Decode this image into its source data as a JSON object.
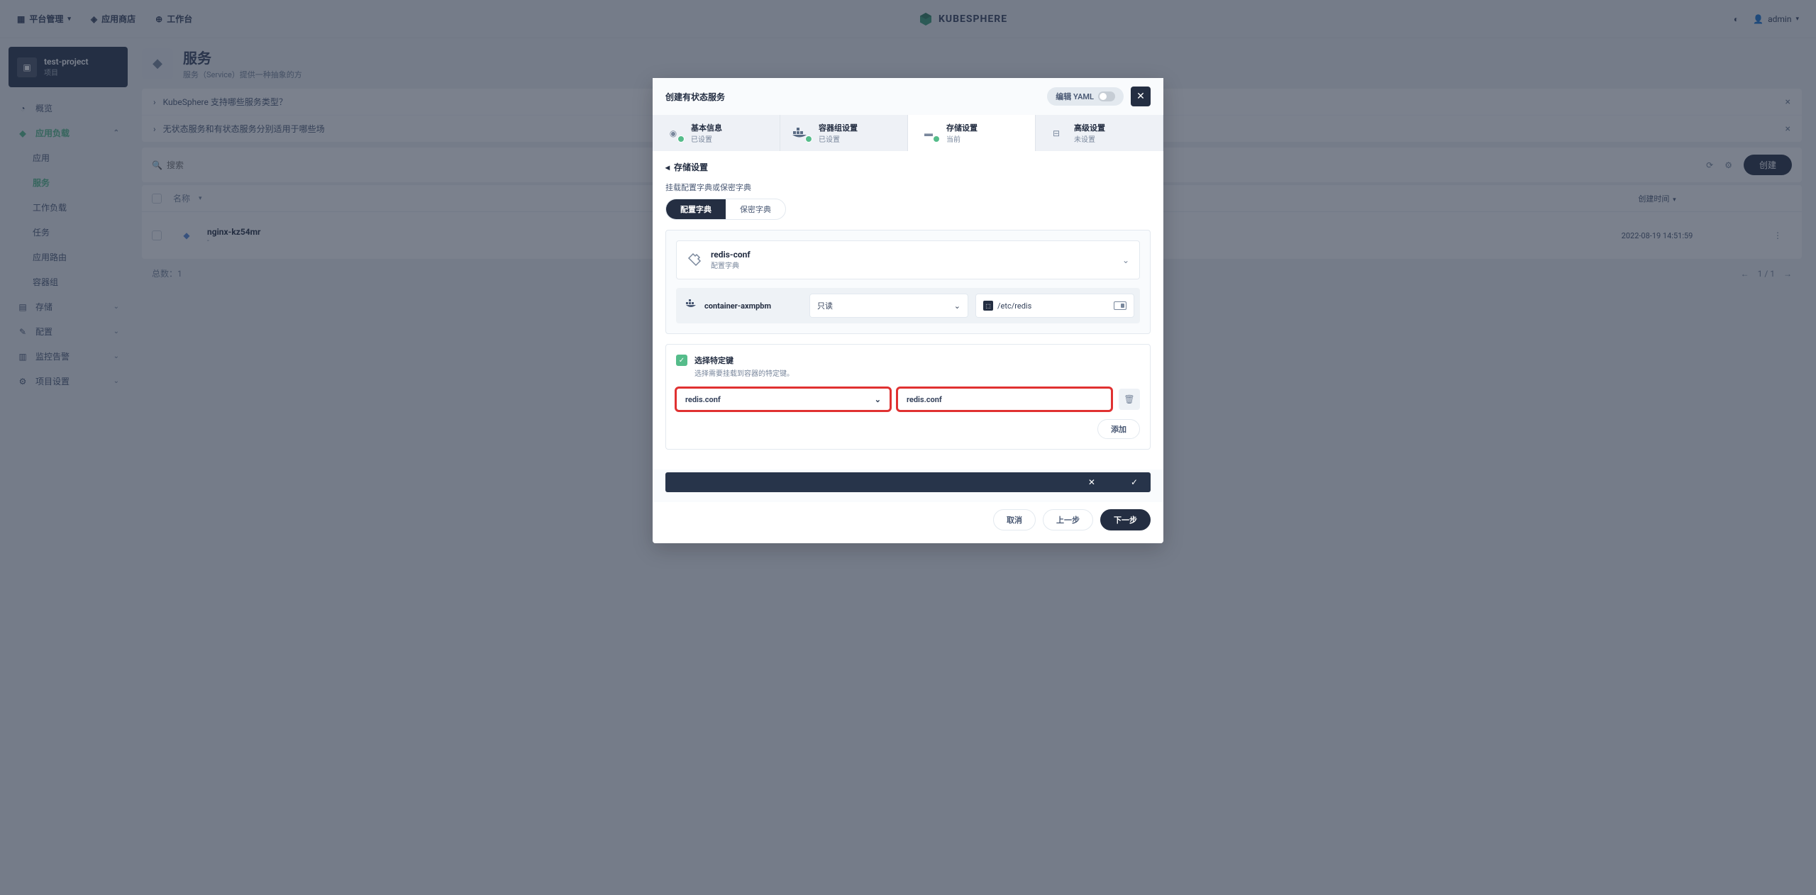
{
  "header": {
    "platform": "平台管理",
    "appstore": "应用商店",
    "workbench": "工作台",
    "brand": "KUBESPHERE",
    "user": "admin"
  },
  "sidebar": {
    "project_name": "test-project",
    "project_label": "项目",
    "items": [
      {
        "label": "概览"
      },
      {
        "label": "应用负载",
        "expanded": true
      },
      {
        "label": "应用",
        "sub": true
      },
      {
        "label": "服务",
        "sub": true,
        "active": true
      },
      {
        "label": "工作负载",
        "sub": true
      },
      {
        "label": "任务",
        "sub": true
      },
      {
        "label": "应用路由",
        "sub": true
      },
      {
        "label": "容器组",
        "sub": true
      },
      {
        "label": "存储",
        "chev": true
      },
      {
        "label": "配置",
        "chev": true
      },
      {
        "label": "监控告警",
        "chev": true
      },
      {
        "label": "项目设置",
        "chev": true
      }
    ]
  },
  "page": {
    "title": "服务",
    "desc": "服务（Service）提供一种抽象的方",
    "faq1": "KubeSphere 支持哪些服务类型？",
    "faq2": "无状态服务和有状态服务分别适用于哪些场"
  },
  "toolbar": {
    "search_ph": "搜索",
    "create": "创建"
  },
  "table": {
    "col_name": "名称",
    "col_time": "创建时间",
    "row_name": "nginx-kz54mr",
    "row_sub": "-",
    "row_time": "2022-08-19 14:51:59",
    "total_label": "总数：",
    "total_val": "1",
    "page": "1 / 1"
  },
  "modal": {
    "title": "创建有状态服务",
    "yaml_label": "编辑 YAML",
    "steps": {
      "s1": {
        "title": "基本信息",
        "sub": "已设置"
      },
      "s2": {
        "title": "容器组设置",
        "sub": "已设置"
      },
      "s3": {
        "title": "存储设置",
        "sub": "当前"
      },
      "s4": {
        "title": "高级设置",
        "sub": "未设置"
      }
    },
    "section_title": "存储设置",
    "mount_label": "挂载配置字典或保密字典",
    "tab_config": "配置字典",
    "tab_secret": "保密字典",
    "cm": {
      "name": "redis-conf",
      "type": "配置字典"
    },
    "container": {
      "name": "container-axmpbm",
      "mode": "只读",
      "path": "/etc/redis"
    },
    "keys": {
      "title": "选择特定键",
      "desc": "选择需要挂载到容器的特定键。",
      "key_sel": "redis.conf",
      "key_inp": "redis.conf",
      "add": "添加"
    },
    "footer": {
      "cancel": "取消",
      "prev": "上一步",
      "next": "下一步"
    }
  }
}
